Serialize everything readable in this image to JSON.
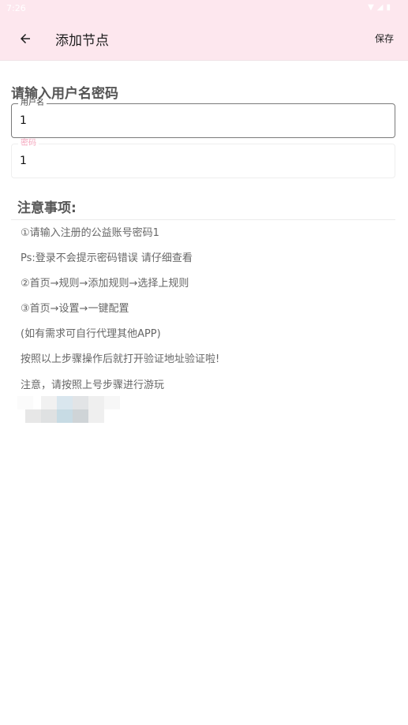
{
  "status_bar": {
    "time": "7:26",
    "icons": [
      "signal-icon",
      "wifi-icon",
      "battery-icon"
    ]
  },
  "app_bar": {
    "title": "添加节点",
    "save_label": "保存"
  },
  "form": {
    "section_title": "请输入用户名密码",
    "username_label": "用户名",
    "username_value": "1",
    "password_label": "密码",
    "password_value": "1"
  },
  "notes": {
    "title": "注意事项:",
    "lines": [
      "①请输入注册的公益账号密码1",
      "Ps:登录不会提示密码错误 请仔细查看",
      "②首页→规则→添加规则→选择上规则",
      "③首页→设置→一键配置",
      "(如有需求可自行代理其他APP)",
      "按照以上步骤操作后就打开验证地址验证啦!",
      "注意，请按照上号步骤进行游玩"
    ]
  },
  "colors": {
    "app_bar_bg": "#fde7ee",
    "accent": "#f4a6bd"
  }
}
